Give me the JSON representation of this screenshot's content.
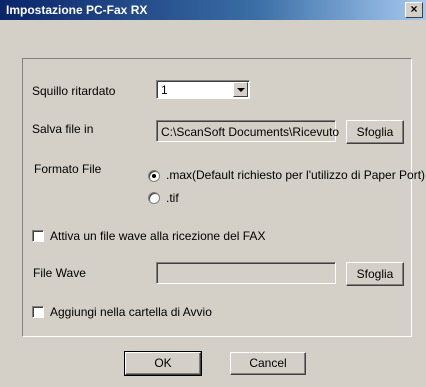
{
  "window": {
    "title": "Impostazione PC-Fax RX",
    "close_glyph": "×"
  },
  "ring_delay": {
    "label": "Squillo ritardato",
    "value": "1"
  },
  "save_file": {
    "label": "Salva file in",
    "value": "C:\\ScanSoft Documents\\Ricevuto",
    "browse_label": "Sfoglia"
  },
  "file_format": {
    "label": "Formato File",
    "options": [
      {
        "label": ".max(Default richiesto per l'utilizzo di Paper Port)",
        "selected": true
      },
      {
        "label": ".tif",
        "selected": false
      }
    ]
  },
  "wave_on_receive": {
    "label": "Attiva un file wave alla ricezione del FAX",
    "checked": false
  },
  "wave_file": {
    "label": "File Wave",
    "value": "",
    "browse_label": "Sfoglia"
  },
  "startup_folder": {
    "label": "Aggiungi nella cartella di Avvio",
    "checked": false
  },
  "buttons": {
    "ok": "OK",
    "cancel": "Cancel"
  }
}
